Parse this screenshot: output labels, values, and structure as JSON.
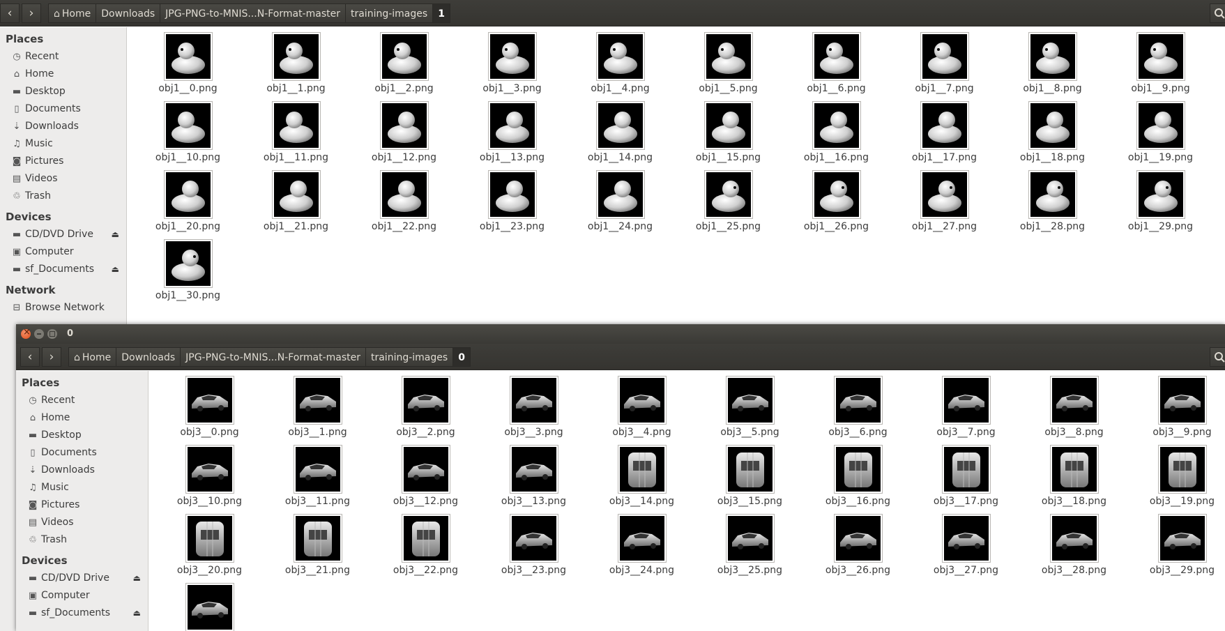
{
  "back_window": {
    "breadcrumbs": [
      "Home",
      "Downloads",
      "JPG-PNG-to-MNIS...N-Format-master",
      "training-images",
      "1"
    ],
    "sidebar": {
      "places_heading": "Places",
      "places": [
        {
          "label": "Recent",
          "icon": "clock-icon"
        },
        {
          "label": "Home",
          "icon": "home-icon"
        },
        {
          "label": "Desktop",
          "icon": "folder-icon"
        },
        {
          "label": "Documents",
          "icon": "document-icon"
        },
        {
          "label": "Downloads",
          "icon": "download-icon"
        },
        {
          "label": "Music",
          "icon": "music-icon"
        },
        {
          "label": "Pictures",
          "icon": "camera-icon"
        },
        {
          "label": "Videos",
          "icon": "film-icon"
        },
        {
          "label": "Trash",
          "icon": "trash-icon"
        }
      ],
      "devices_heading": "Devices",
      "devices": [
        {
          "label": "CD/DVD Drive",
          "icon": "drive-icon",
          "eject": true
        },
        {
          "label": "Computer",
          "icon": "computer-icon",
          "eject": false
        },
        {
          "label": "sf_Documents",
          "icon": "drive-icon",
          "eject": true
        }
      ],
      "network_heading": "Network",
      "network": [
        {
          "label": "Browse Network",
          "icon": "network-icon"
        }
      ]
    },
    "files": [
      "obj1__0.png",
      "obj1__1.png",
      "obj1__2.png",
      "obj1__3.png",
      "obj1__4.png",
      "obj1__5.png",
      "obj1__6.png",
      "obj1__7.png",
      "obj1__8.png",
      "obj1__9.png",
      "obj1__10.png",
      "obj1__11.png",
      "obj1__12.png",
      "obj1__13.png",
      "obj1__14.png",
      "obj1__15.png",
      "obj1__16.png",
      "obj1__17.png",
      "obj1__18.png",
      "obj1__19.png",
      "obj1__20.png",
      "obj1__21.png",
      "obj1__22.png",
      "obj1__23.png",
      "obj1__24.png",
      "obj1__25.png",
      "obj1__26.png",
      "obj1__27.png",
      "obj1__28.png",
      "obj1__29.png",
      "obj1__30.png"
    ]
  },
  "front_window": {
    "title": "0",
    "breadcrumbs": [
      "Home",
      "Downloads",
      "JPG-PNG-to-MNIS...N-Format-master",
      "training-images",
      "0"
    ],
    "sidebar": {
      "places_heading": "Places",
      "places": [
        {
          "label": "Recent",
          "icon": "clock-icon"
        },
        {
          "label": "Home",
          "icon": "home-icon"
        },
        {
          "label": "Desktop",
          "icon": "folder-icon"
        },
        {
          "label": "Documents",
          "icon": "document-icon"
        },
        {
          "label": "Downloads",
          "icon": "download-icon"
        },
        {
          "label": "Music",
          "icon": "music-icon"
        },
        {
          "label": "Pictures",
          "icon": "camera-icon"
        },
        {
          "label": "Videos",
          "icon": "film-icon"
        },
        {
          "label": "Trash",
          "icon": "trash-icon"
        }
      ],
      "devices_heading": "Devices",
      "devices": [
        {
          "label": "CD/DVD Drive",
          "icon": "drive-icon",
          "eject": true
        },
        {
          "label": "Computer",
          "icon": "computer-icon",
          "eject": false
        },
        {
          "label": "sf_Documents",
          "icon": "drive-icon",
          "eject": true
        }
      ]
    },
    "files": [
      "obj3__0.png",
      "obj3__1.png",
      "obj3__2.png",
      "obj3__3.png",
      "obj3__4.png",
      "obj3__5.png",
      "obj3__6.png",
      "obj3__7.png",
      "obj3__8.png",
      "obj3__9.png",
      "obj3__10.png",
      "obj3__11.png",
      "obj3__12.png",
      "obj3__13.png",
      "obj3__14.png",
      "obj3__15.png",
      "obj3__16.png",
      "obj3__17.png",
      "obj3__18.png",
      "obj3__19.png",
      "obj3__20.png",
      "obj3__21.png",
      "obj3__22.png",
      "obj3__23.png",
      "obj3__24.png",
      "obj3__25.png",
      "obj3__26.png",
      "obj3__27.png",
      "obj3__28.png",
      "obj3__29.png",
      ""
    ]
  },
  "icons": {
    "back": "‹",
    "forward": "›",
    "home": "⌂",
    "eject": "⏏"
  },
  "colors": {
    "titlebar": "#3c3b37",
    "close_button": "#df4b16",
    "sidebar": "#edeceb",
    "thumb_bg": "#000000"
  }
}
